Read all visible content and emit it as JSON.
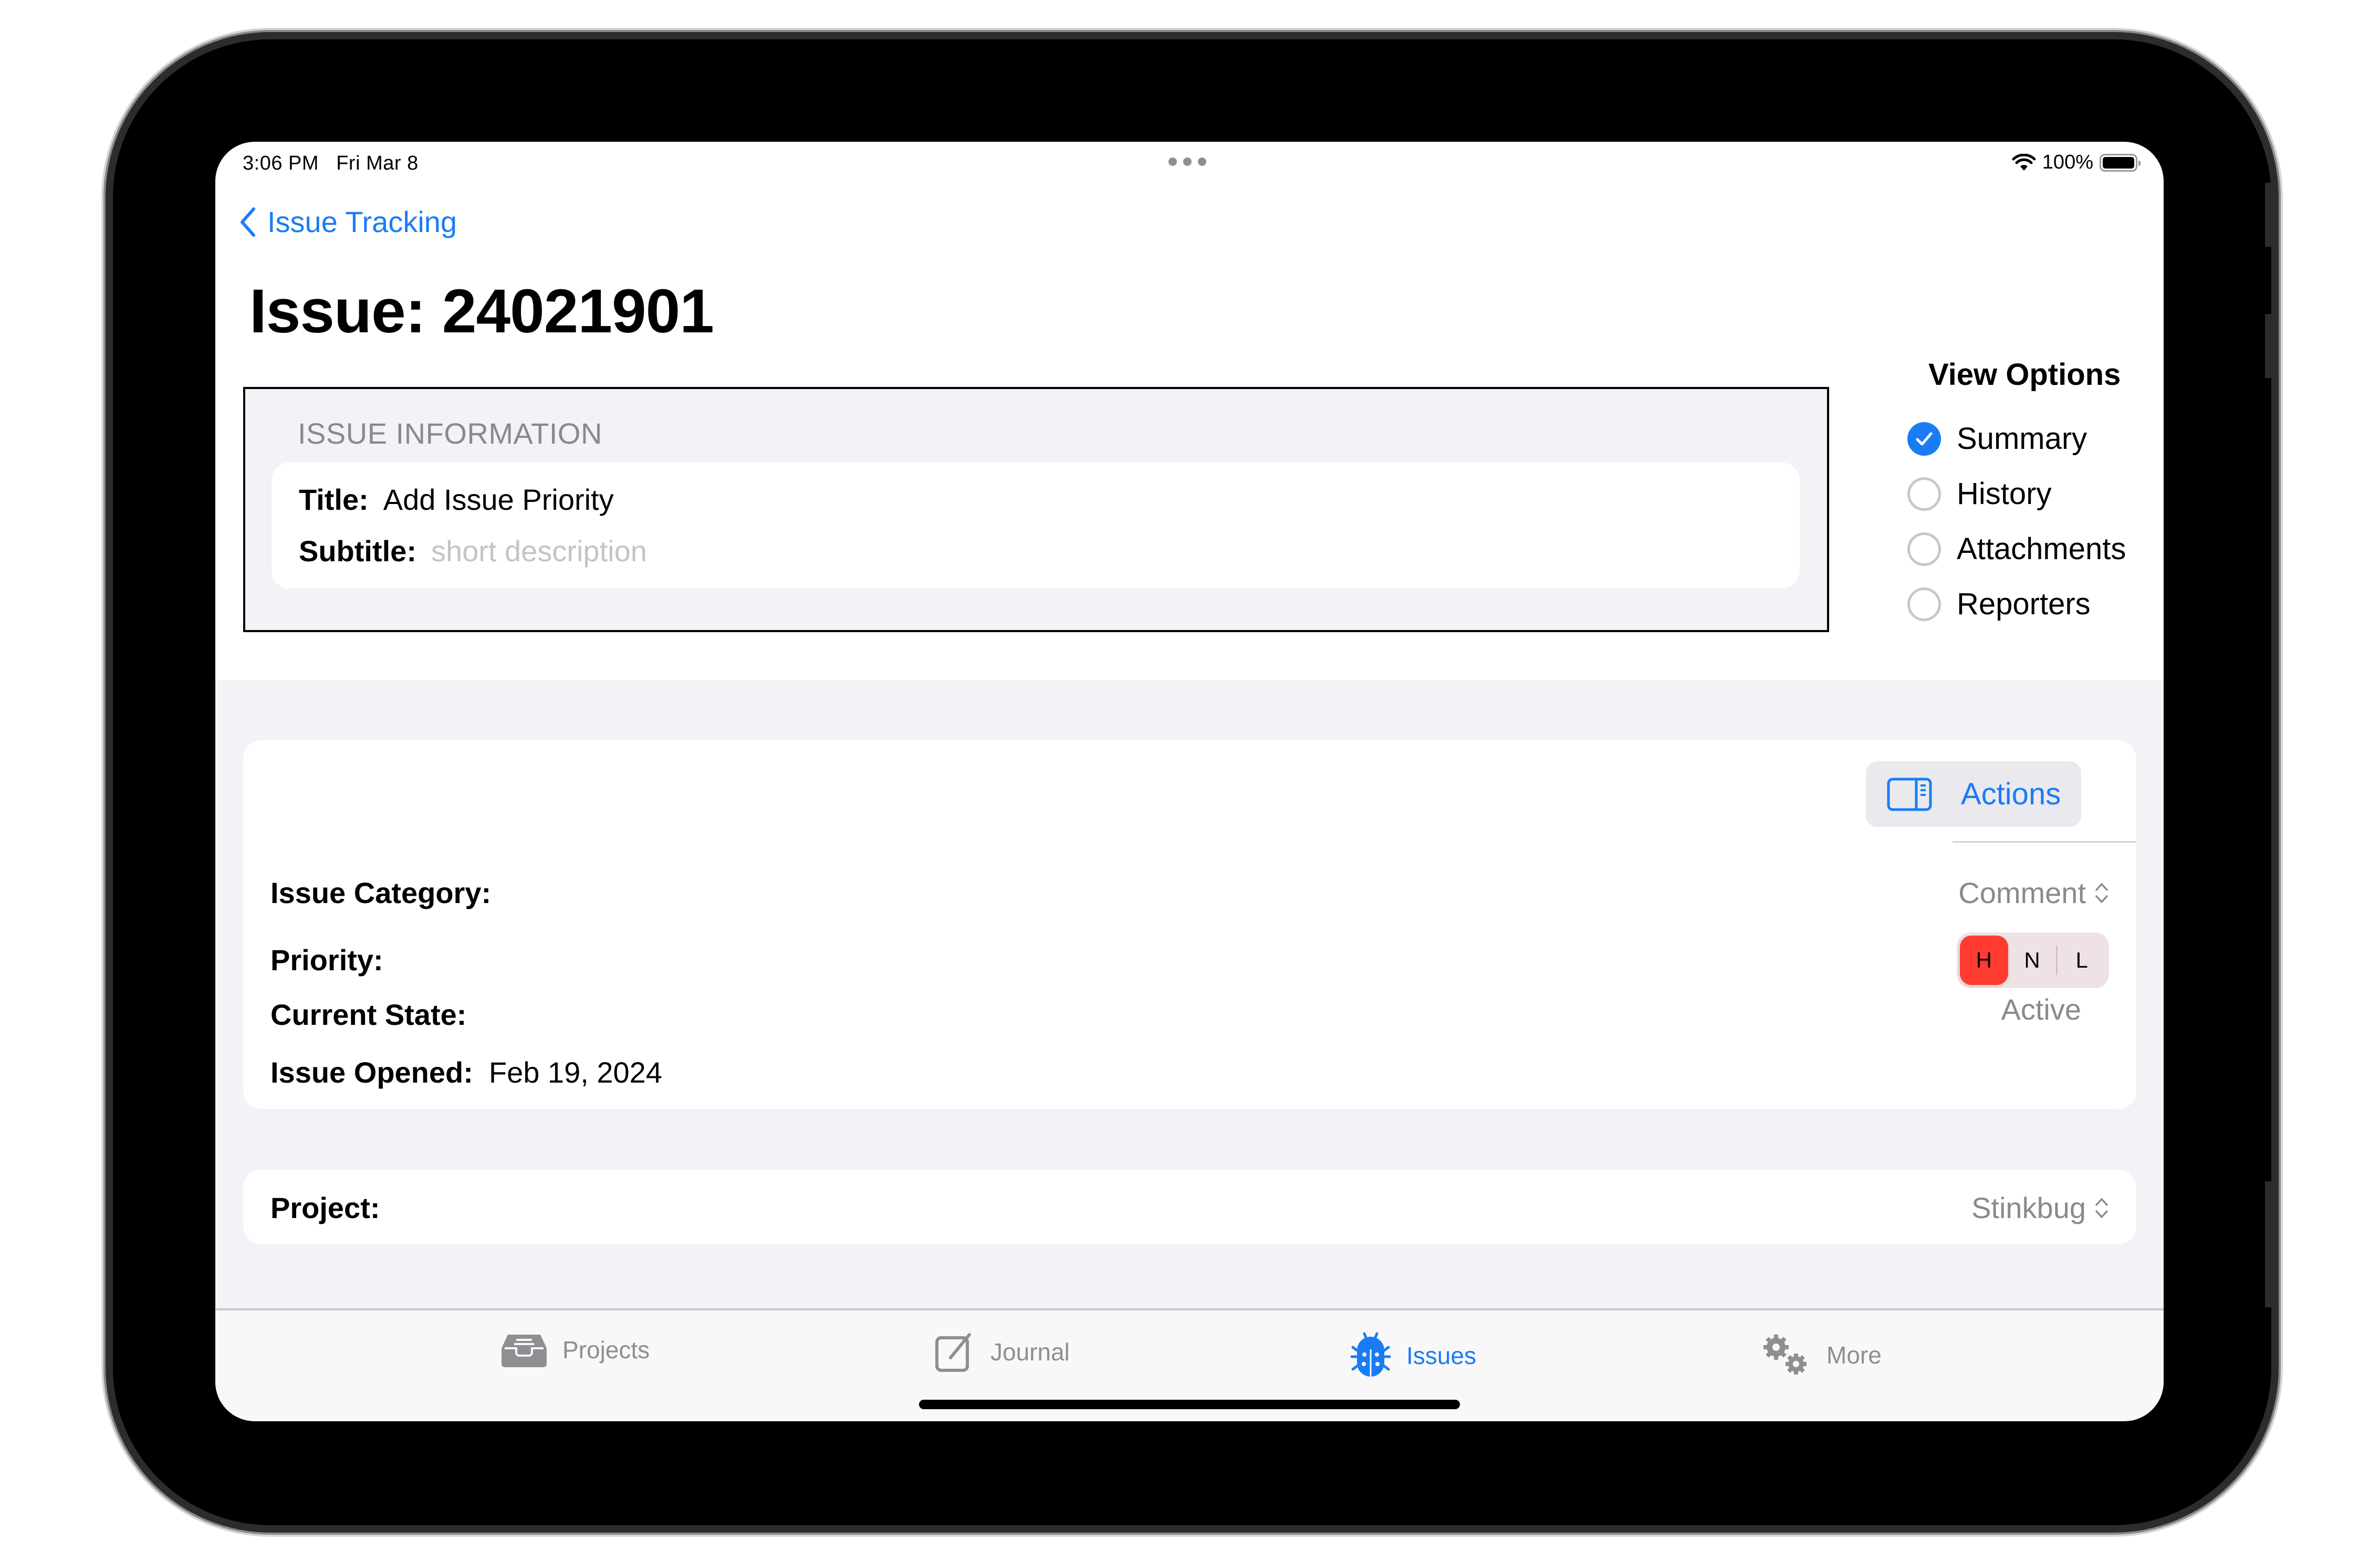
{
  "status_bar": {
    "time": "3:06 PM",
    "date": "Fri Mar 8",
    "battery_percent": "100%",
    "battery_level": 1.0,
    "icons": [
      "multitasking-dots-icon",
      "wifi-icon",
      "battery-icon"
    ]
  },
  "nav": {
    "back_label": "Issue Tracking",
    "title": "Issue: 24021901"
  },
  "issue_information": {
    "header": "ISSUE INFORMATION",
    "title_label": "Title:",
    "title_value": "Add Issue Priority",
    "subtitle_label": "Subtitle:",
    "subtitle_placeholder": "short description"
  },
  "view_options": {
    "title": "View Options",
    "items": [
      {
        "label": "Summary",
        "checked": true
      },
      {
        "label": "History",
        "checked": false
      },
      {
        "label": "Attachments",
        "checked": false
      },
      {
        "label": "Reporters",
        "checked": false
      }
    ]
  },
  "details": {
    "actions_label": "Actions",
    "category_label": "Issue Category:",
    "category_value": "Comment",
    "priority_label": "Priority:",
    "priority_options": [
      "H",
      "N",
      "L"
    ],
    "priority_selected": "H",
    "state_label": "Current State:",
    "state_value": "Active",
    "opened_label": "Issue Opened:",
    "opened_value": "Feb 19, 2024"
  },
  "project": {
    "label": "Project:",
    "value": "Stinkbug"
  },
  "tabbar": {
    "tabs": [
      {
        "label": "Projects",
        "icon": "tray-icon",
        "active": false
      },
      {
        "label": "Journal",
        "icon": "compose-icon",
        "active": false
      },
      {
        "label": "Issues",
        "icon": "ladybug-icon",
        "active": true
      },
      {
        "label": "More",
        "icon": "gears-icon",
        "active": false
      }
    ]
  },
  "colors": {
    "accent": "#1a7cf5",
    "priority_high": "#ff3b30",
    "secondary_text": "#8a8a8e",
    "grouped_background": "#f2f2f7"
  }
}
